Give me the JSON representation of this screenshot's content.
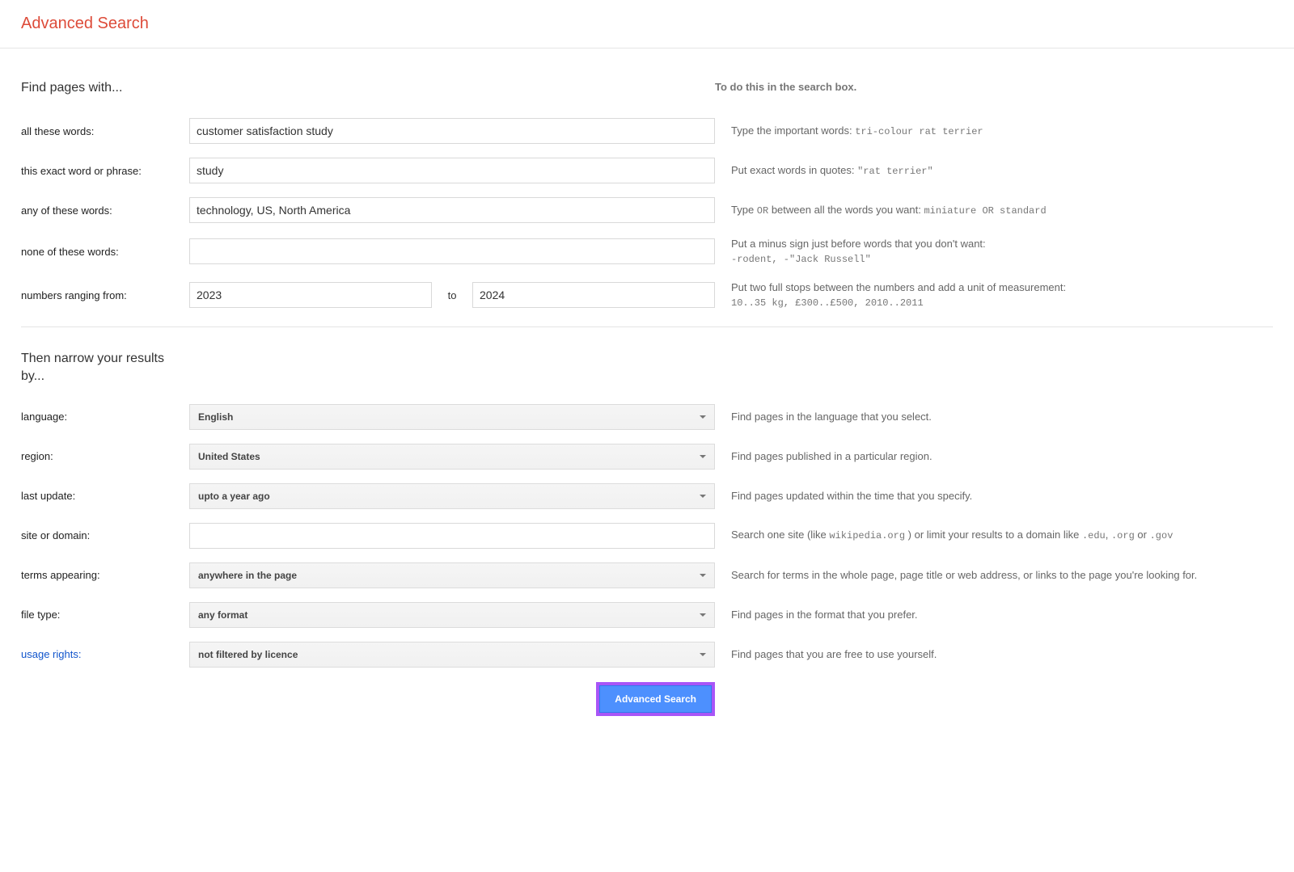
{
  "header": {
    "title": "Advanced Search"
  },
  "section1": {
    "title": "Find pages with...",
    "hint": "To do this in the search box."
  },
  "fields": {
    "all_words": {
      "label": "all these words:",
      "value": "customer satisfaction study",
      "hint_prefix": "Type the important words: ",
      "hint_code": "tri-colour rat terrier"
    },
    "exact": {
      "label": "this exact word or phrase:",
      "value": "study",
      "hint_prefix": "Put exact words in quotes: ",
      "hint_code": "\"rat terrier\""
    },
    "any_words": {
      "label": "any of these words:",
      "value": "technology, US, North America",
      "hint_prefix": "Type ",
      "hint_code1": "OR",
      "hint_middle": " between all the words you want: ",
      "hint_code2": "miniature OR standard"
    },
    "none_words": {
      "label": "none of these words:",
      "value": "",
      "hint_line1": "Put a minus sign just before words that you don't want:",
      "hint_code": "-rodent, -\"Jack Russell\""
    },
    "range": {
      "label": "numbers ranging from:",
      "from": "2023",
      "to_label": "to",
      "to": "2024",
      "hint_line1": "Put two full stops between the numbers and add a unit of measurement:",
      "hint_code": "10..35 kg, £300..£500, 2010..2011"
    }
  },
  "section2": {
    "title": "Then narrow your results by..."
  },
  "narrow": {
    "language": {
      "label": "language:",
      "value": "English",
      "hint": "Find pages in the language that you select."
    },
    "region": {
      "label": "region:",
      "value": "United States",
      "hint": "Find pages published in a particular region."
    },
    "last_update": {
      "label": "last update:",
      "value": "upto a year ago",
      "hint": "Find pages updated within the time that you specify."
    },
    "site": {
      "label": "site or domain:",
      "value": "",
      "hint_prefix": "Search one site (like ",
      "hint_code1": "wikipedia.org",
      "hint_middle": " ) or limit your results to a domain like ",
      "hint_code2": ".edu",
      "hint_sep1": ", ",
      "hint_code3": ".org",
      "hint_sep2": " or ",
      "hint_code4": ".gov"
    },
    "terms": {
      "label": "terms appearing:",
      "value": "anywhere in the page",
      "hint": "Search for terms in the whole page, page title or web address, or links to the page you're looking for."
    },
    "filetype": {
      "label": "file type:",
      "value": "any format",
      "hint": "Find pages in the format that you prefer."
    },
    "usage": {
      "label": "usage rights:",
      "value": "not filtered by licence",
      "hint": "Find pages that you are free to use yourself."
    }
  },
  "submit": {
    "label": "Advanced Search"
  }
}
